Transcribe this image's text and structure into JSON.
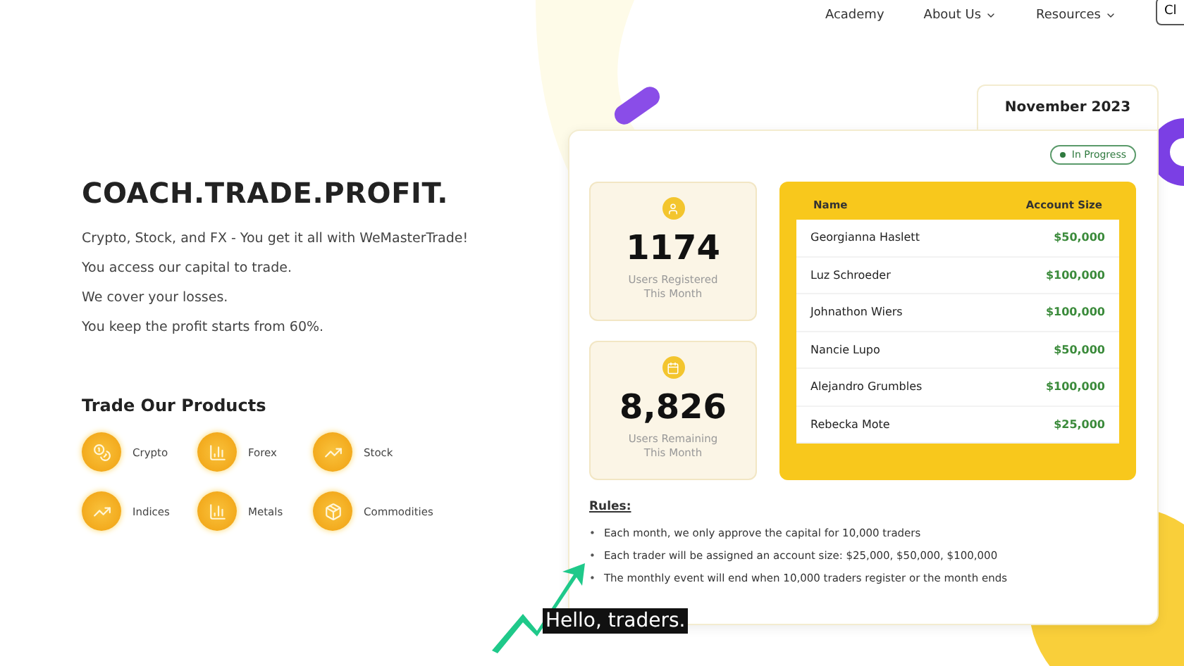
{
  "nav": {
    "items": [
      {
        "label": "Academy",
        "dropdown": false
      },
      {
        "label": "About Us",
        "dropdown": true
      },
      {
        "label": "Resources",
        "dropdown": true
      }
    ],
    "button": "Cl"
  },
  "hero": {
    "title": "COACH.TRADE.PROFIT.",
    "lines": [
      "Crypto, Stock, and FX - You get it all with WeMasterTrade!",
      "You access our capital to trade.",
      "We cover your losses.",
      "You keep the profit starts from 60%."
    ]
  },
  "products": {
    "title": "Trade Our Products",
    "items": [
      {
        "label": "Crypto",
        "kind": "coins"
      },
      {
        "label": "Forex",
        "kind": "bars"
      },
      {
        "label": "Stock",
        "kind": "chart"
      },
      {
        "label": "Indices",
        "kind": "chart"
      },
      {
        "label": "Metals",
        "kind": "bars"
      },
      {
        "label": "Commodities",
        "kind": "boxes"
      }
    ]
  },
  "event": {
    "month": "November 2023",
    "status": "In Progress",
    "stats": [
      {
        "kind": "user",
        "value": "1174",
        "label": "Users Registered This Month"
      },
      {
        "kind": "calendar",
        "value": "8,826",
        "label": "Users Remaining This Month"
      }
    ],
    "table": {
      "columns": [
        "Name",
        "Account Size"
      ],
      "rows": [
        [
          "Georgianna Haslett",
          "$50,000"
        ],
        [
          "Luz Schroeder",
          "$100,000"
        ],
        [
          "Johnathon Wiers",
          "$100,000"
        ],
        [
          "Nancie Lupo",
          "$50,000"
        ],
        [
          "Alejandro Grumbles",
          "$100,000"
        ],
        [
          "Rebecka Mote",
          "$25,000"
        ]
      ]
    },
    "rules_title": "Rules:",
    "rule_marker": "•",
    "rules": [
      "Each month, we only approve the capital for 10,000 traders",
      "Each trader will be assigned an account size: $25,000, $50,000, $100,000",
      "The monthly event will end when 10,000 traders register or the month ends"
    ]
  },
  "caption": "Hello, traders."
}
